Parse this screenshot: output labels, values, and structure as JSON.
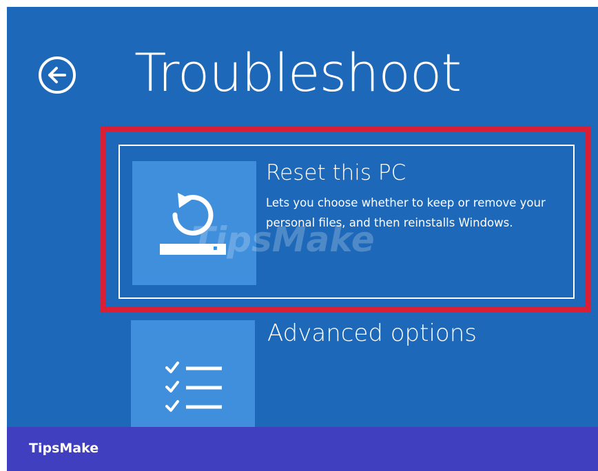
{
  "screen": {
    "title": "Troubleshoot",
    "background_color": "#1d68b9",
    "back_icon": "arrow-left-circle-icon"
  },
  "options": [
    {
      "title": "Reset this PC",
      "description": "Lets you choose whether to keep or remove your personal files, and then reinstalls Windows.",
      "icon": "reset-pc-icon",
      "highlighted": true
    },
    {
      "title": "Advanced options",
      "description": "",
      "icon": "checklist-icon",
      "highlighted": false
    }
  ],
  "highlight_color": "#d81f35",
  "tile_color": "#3f8fdd",
  "watermark": {
    "text": "TipsMake"
  },
  "footer": {
    "logo_text": "TipsMake",
    "background_color": "#3f3fc0"
  }
}
